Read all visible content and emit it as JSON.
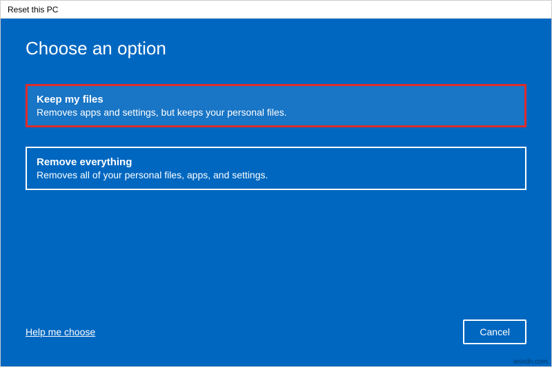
{
  "window": {
    "title": "Reset this PC"
  },
  "heading": "Choose an option",
  "options": [
    {
      "title": "Keep my files",
      "description": "Removes apps and settings, but keeps your personal files."
    },
    {
      "title": "Remove everything",
      "description": "Removes all of your personal files, apps, and settings."
    }
  ],
  "footer": {
    "help_link": "Help me choose",
    "cancel_label": "Cancel"
  },
  "watermark": "wsxdn.com",
  "colors": {
    "background": "#0067c0",
    "highlight_border": "#e02b2b",
    "highlight_bg": "#1975c5"
  }
}
